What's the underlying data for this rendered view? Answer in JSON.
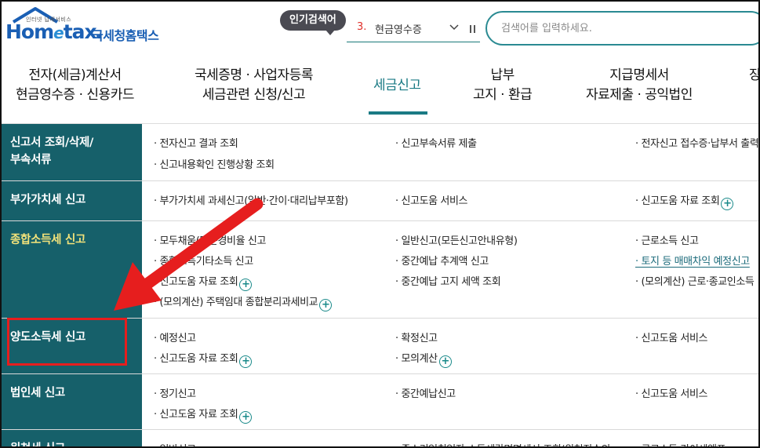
{
  "header": {
    "logo_sub": "인터넷 납세서비스",
    "logo_main_prefix": "Hom",
    "logo_main_e": "e",
    "logo_main_suffix": "tax.",
    "logo_kr": "국세청홈택스",
    "popular_label": "인기검색어",
    "popular_rank": "3.",
    "popular_term": "현금영수증",
    "search_placeholder": "검색어를 입력하세요."
  },
  "nav": {
    "items": [
      {
        "line1": "전자(세금)계산서",
        "line2": "현금영수증 · 신용카드"
      },
      {
        "line1": "국세증명 · 사업자등록",
        "line2": "세금관련 신청/신고"
      },
      {
        "line1": "세금신고",
        "line2": ""
      },
      {
        "line1": "납부",
        "line2": "고지 · 환급"
      },
      {
        "line1": "지급명세서",
        "line2": "자료제출 · 공익법인"
      },
      {
        "line1": "장",
        "line2": ""
      }
    ]
  },
  "menu": {
    "rows": [
      {
        "category": [
          "신고서 조회/삭제/",
          "부속서류"
        ],
        "items": [
          "· 전자신고 결과 조회",
          "· 신고부속서류 제출",
          "· 전자신고 접수증·납부서 출력",
          "· 신고내용확인 진행상황 조회"
        ]
      },
      {
        "category": [
          "부가가치세 신고"
        ],
        "items": [
          "· 부가가치세 과세신고(일반·간이·대리납부포함)",
          "· 신고도움 서비스",
          "· 신고도움 자료 조회"
        ]
      },
      {
        "category": [
          "종합소득세 신고"
        ],
        "items": [
          "· 모두채움(단순경비율 신고",
          "· 일반신고(모든신고안내유형)",
          "· 근로소득 신고",
          "· 종합소득기타소득 신고",
          "· 중간예납 추계액 신고",
          "· 토지 등 매매차익 예정신고",
          "· 신고도움 자료 조회",
          "· 중간예납 고지 세액 조회",
          "· (모의계산) 근로·종교인소득",
          "· (모의계산) 주택임대 종합분리과세비교"
        ]
      },
      {
        "category": [
          "양도소득세 신고"
        ],
        "items": [
          "· 예정신고",
          "· 확정신고",
          "· 신고도움 서비스",
          "· 신고도움 자료 조회",
          "· 모의계산"
        ]
      },
      {
        "category": [
          "법인세 신고"
        ],
        "items": [
          "· 정기신고",
          "· 중간예납신고",
          "· 신고도움 서비스",
          "· 신고도움 자료 조회"
        ]
      },
      {
        "category": [
          "원천세 신고"
        ],
        "items": [
          "· 일반신고",
          "· 중소기업취업자 소득세감면명세서 조회(원천징수의",
          "· 근로소득 간이세액표"
        ]
      }
    ]
  },
  "colors": {
    "sidebar_bg": "#16606a",
    "accent": "#1a7a84",
    "highlight_text": "#f2e27a",
    "annotation_red": "#e61e1e"
  }
}
